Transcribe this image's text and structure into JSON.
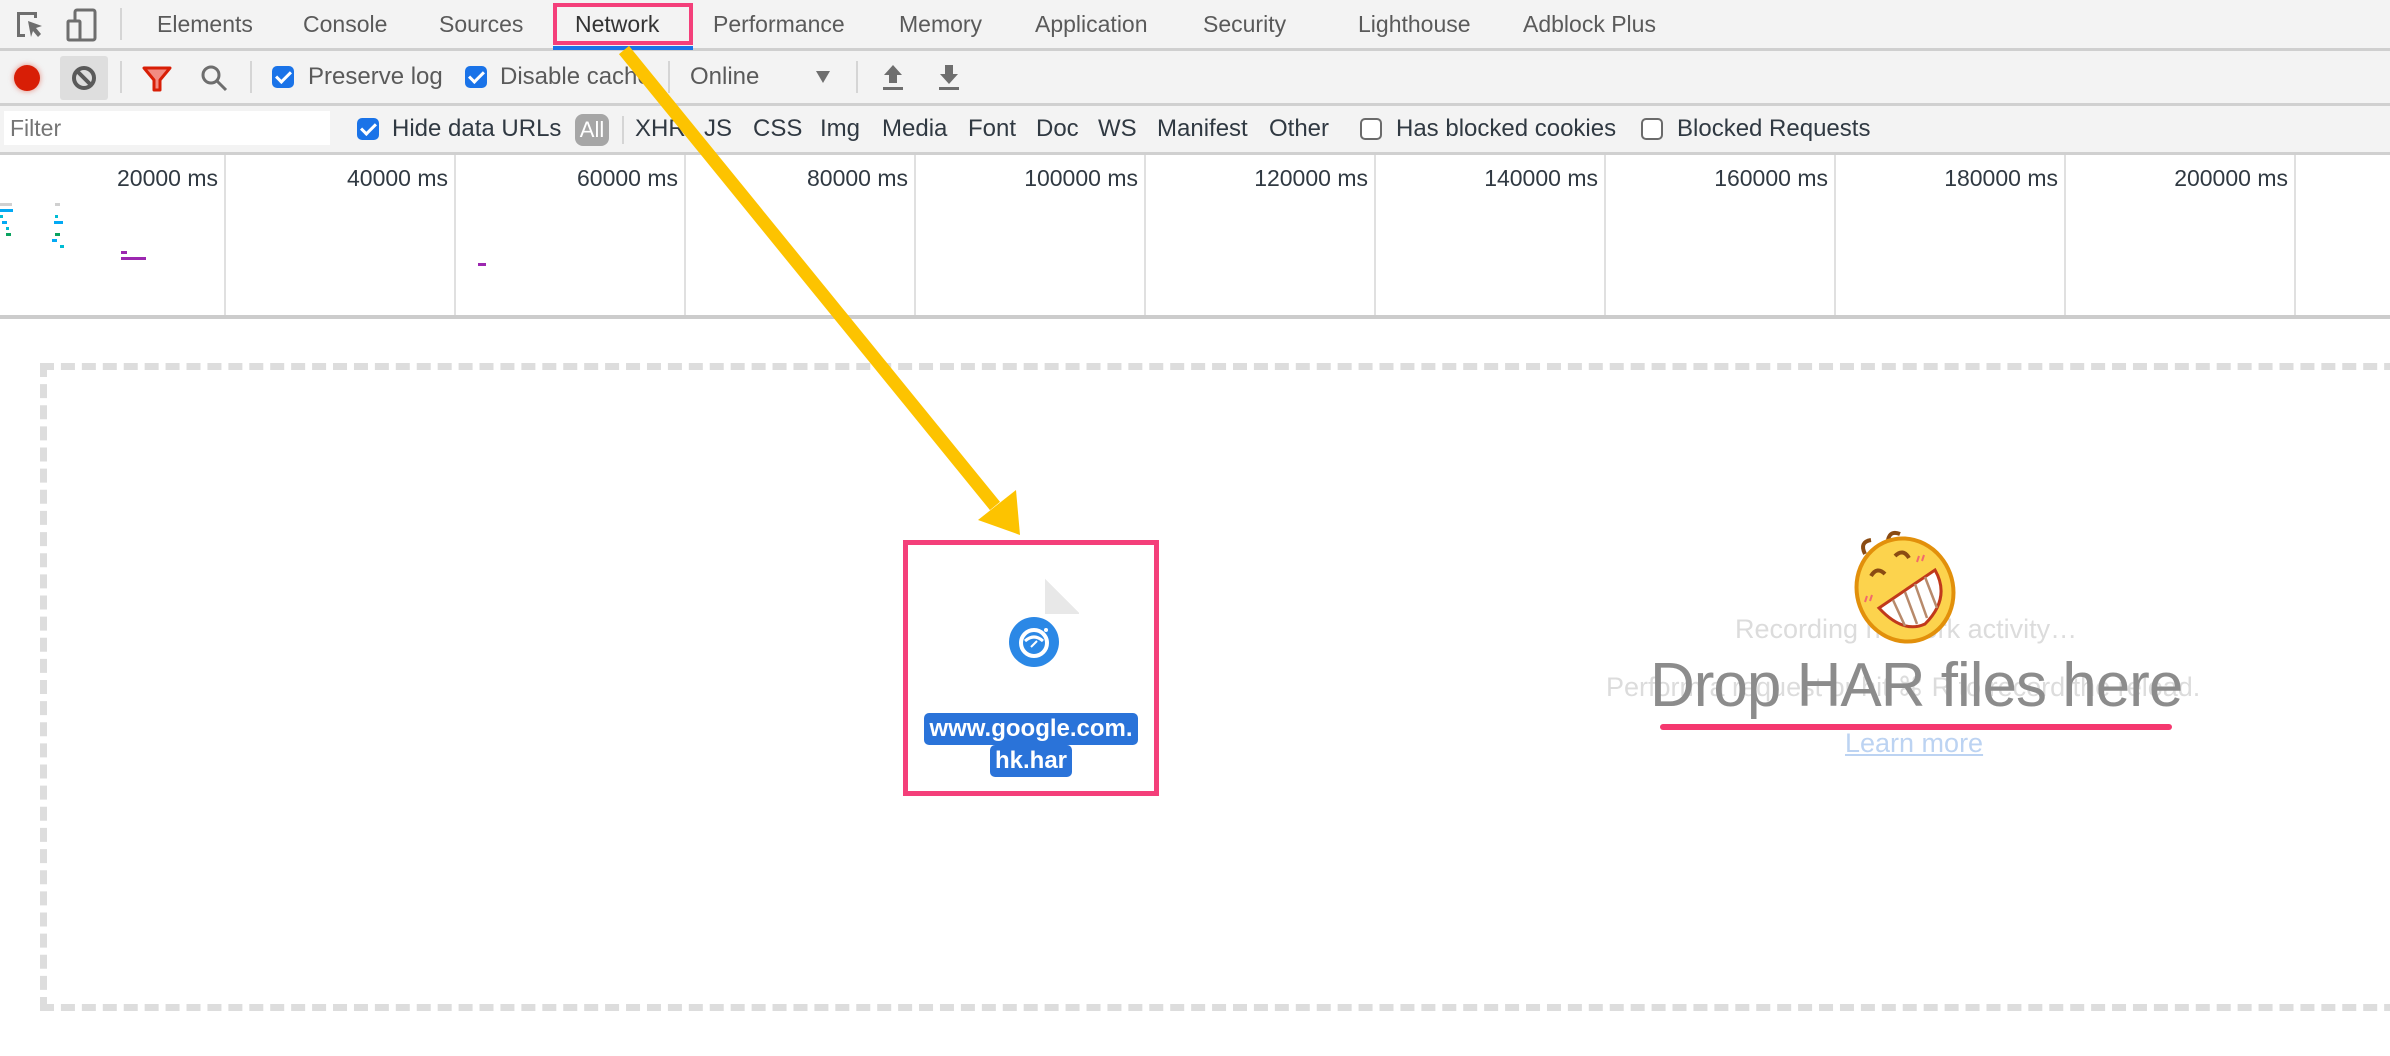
{
  "tabs": [
    {
      "label": "Elements"
    },
    {
      "label": "Console"
    },
    {
      "label": "Sources"
    },
    {
      "label": "Network",
      "active": true
    },
    {
      "label": "Performance"
    },
    {
      "label": "Memory"
    },
    {
      "label": "Application"
    },
    {
      "label": "Security"
    },
    {
      "label": "Lighthouse"
    },
    {
      "label": "Adblock Plus"
    }
  ],
  "toolbar": {
    "preserve_log": {
      "label": "Preserve log",
      "checked": true
    },
    "disable_cache": {
      "label": "Disable cache",
      "checked": true
    },
    "throttle": {
      "selected": "Online"
    }
  },
  "filter": {
    "placeholder": "Filter",
    "hide_data_urls": {
      "label": "Hide data URLs",
      "checked": true
    },
    "types": [
      "All",
      "XHR",
      "JS",
      "CSS",
      "Img",
      "Media",
      "Font",
      "Doc",
      "WS",
      "Manifest",
      "Other"
    ],
    "active_type": "All",
    "has_blocked_cookies": {
      "label": "Has blocked cookies",
      "checked": false
    },
    "blocked_requests": {
      "label": "Blocked Requests",
      "checked": false
    }
  },
  "timeline": {
    "ticks": [
      "20000 ms",
      "40000 ms",
      "60000 ms",
      "80000 ms",
      "100000 ms",
      "120000 ms",
      "140000 ms",
      "160000 ms",
      "180000 ms",
      "200000 ms"
    ]
  },
  "empty_state": {
    "recording": "Recording network activity…",
    "hint": "Perform a request or hit ⌘ R to record the reload.",
    "learn_more": "Learn more"
  },
  "overlay": {
    "drop_title": "Drop HAR files here",
    "file_name_line1": "www.google.com.",
    "file_name_line2": "hk.har",
    "colors": {
      "highlight": "#f43f7a",
      "arrow": "#fdc300",
      "accent": "#1a73e8"
    }
  }
}
